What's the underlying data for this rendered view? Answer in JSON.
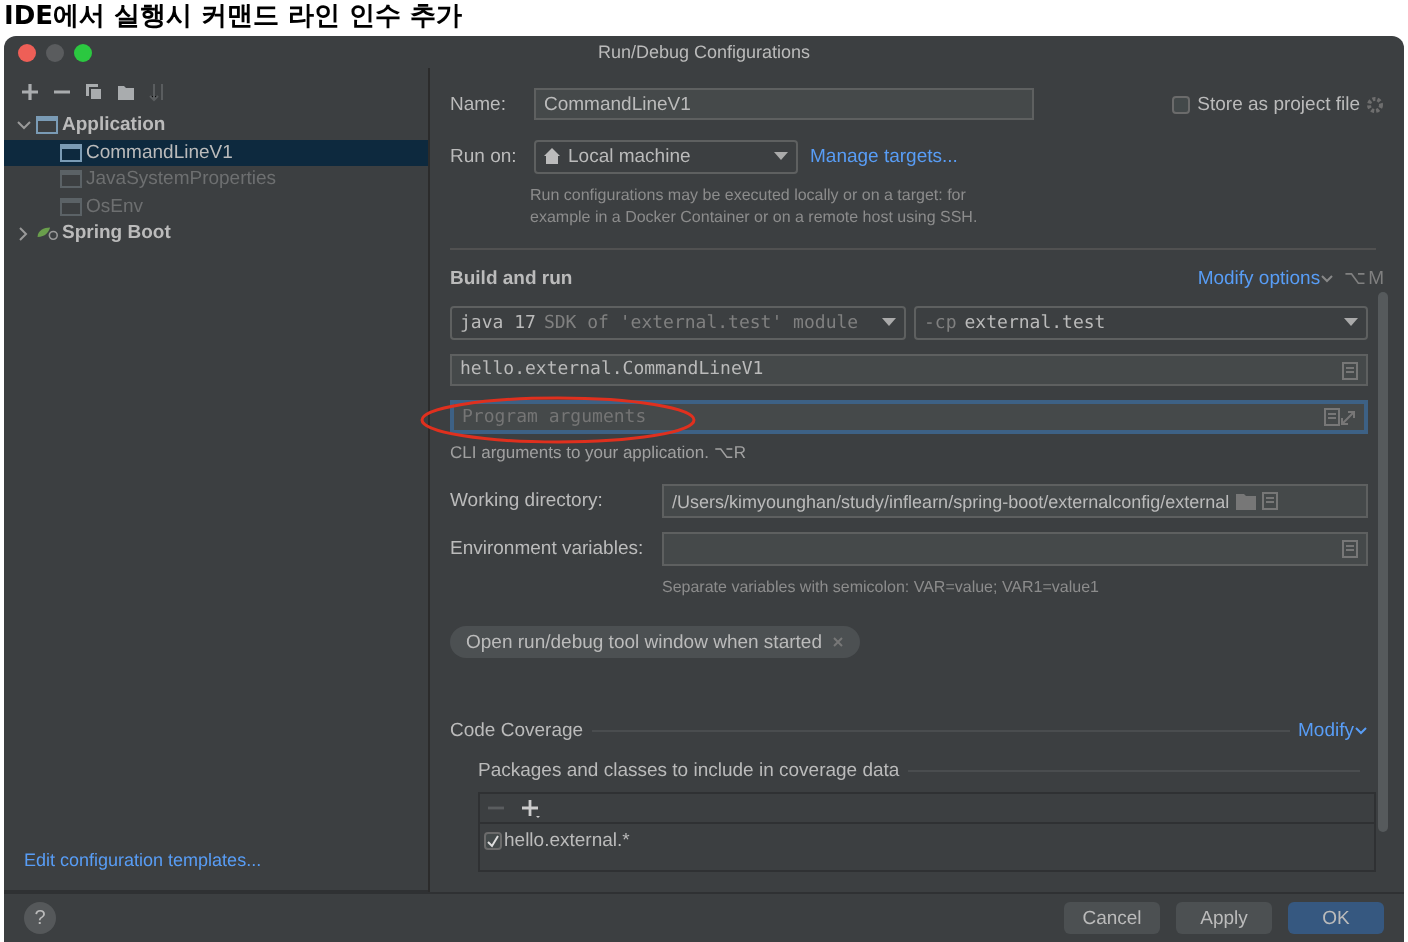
{
  "caption": "IDE에서 실행시 커맨드 라인 인수 추가",
  "window": {
    "title": "Run/Debug Configurations"
  },
  "sidebar": {
    "toolbar": [
      {
        "kind": "add",
        "disabled": false
      },
      {
        "kind": "remove",
        "disabled": false
      },
      {
        "kind": "copy",
        "disabled": false
      },
      {
        "kind": "folder",
        "disabled": false
      },
      {
        "kind": "sort",
        "disabled": true
      }
    ],
    "tree": [
      {
        "label": "Application",
        "kind": "application",
        "expanded": true,
        "selected": false,
        "disabled": false,
        "children": [
          {
            "label": "CommandLineV1",
            "kind": "application",
            "selected": true,
            "disabled": false
          },
          {
            "label": "JavaSystemProperties",
            "kind": "application",
            "selected": false,
            "disabled": true
          },
          {
            "label": "OsEnv",
            "kind": "application",
            "selected": false,
            "disabled": true
          }
        ]
      },
      {
        "label": "Spring Boot",
        "kind": "spring",
        "expanded": false,
        "selected": false,
        "disabled": false
      }
    ],
    "footer_link": "Edit configuration templates..."
  },
  "form": {
    "name": {
      "label": "Name:",
      "value": "CommandLineV1"
    },
    "store_as_project_file": {
      "label": "Store as project file",
      "checked": false
    },
    "run_on": {
      "label": "Run on:",
      "value": "Local machine",
      "link": "Manage targets...",
      "help": "Run configurations may be executed locally or on a target: for example in a Docker Container or on a remote host using SSH."
    },
    "build_and_run": {
      "title": "Build and run",
      "modify_options": "Modify options",
      "shortcut": "⌥M",
      "jdk": {
        "version": "java 17",
        "detail": "SDK of 'external.test' module"
      },
      "classpath": {
        "prefix": "-cp",
        "value": "external.test"
      },
      "main_class": "hello.external.CommandLineV1",
      "program_arguments": {
        "placeholder": "Program arguments",
        "focused": true
      },
      "program_arguments_help": "CLI arguments to your application. ⌥R"
    },
    "working_directory": {
      "label": "Working directory:",
      "value": "/Users/kimyounghan/study/inflearn/spring-boot/externalconfig/external"
    },
    "environment_variables": {
      "label": "Environment variables:",
      "help": "Separate variables with semicolon: VAR=value; VAR1=value1"
    },
    "option_chip": "Open run/debug tool window when started",
    "code_coverage": {
      "title": "Code Coverage",
      "modify": "Modify",
      "packages_title": "Packages and classes to include in coverage data",
      "entries": [
        {
          "label": "hello.external.*",
          "checked": true
        }
      ]
    }
  },
  "help_button": "?",
  "buttons": [
    {
      "label": "Cancel",
      "kind": "default"
    },
    {
      "label": "Apply",
      "kind": "default"
    },
    {
      "label": "OK",
      "kind": "primary"
    }
  ]
}
